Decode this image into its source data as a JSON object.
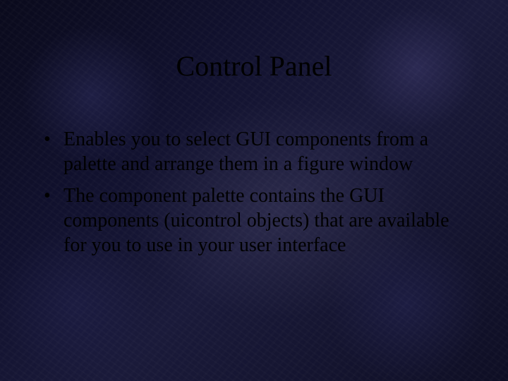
{
  "slide": {
    "title": "Control Panel",
    "bullets": [
      "Enables you to select GUI components from a palette and arrange them in a figure window",
      "The component palette contains the GUI components (uicontrol objects) that are available for you to use in your user interface"
    ]
  }
}
